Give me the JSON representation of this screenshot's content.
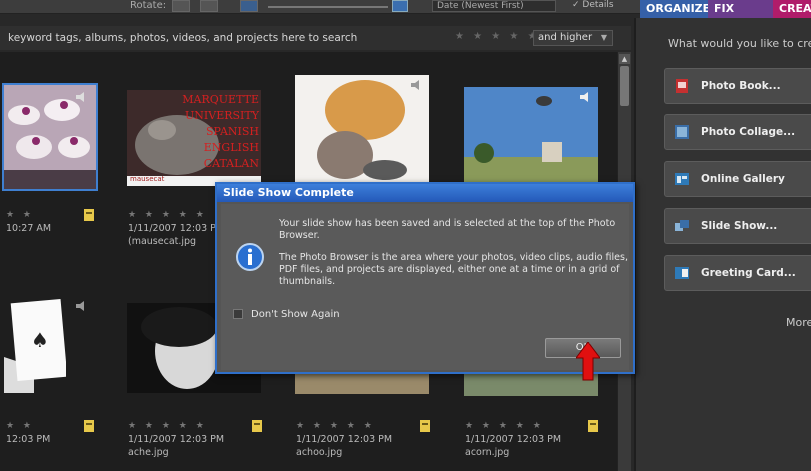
{
  "toolbar": {
    "rotate_label": "Rotate:",
    "sort_value": "Date (Newest First)",
    "details_label": "Details"
  },
  "tabs": [
    {
      "label": "ORGANIZE"
    },
    {
      "label": "FIX"
    },
    {
      "label": "CREATE"
    }
  ],
  "search": {
    "hint": "keyword tags, albums, photos, videos, and projects here to search",
    "rating_filter": "and higher"
  },
  "grid": {
    "items": [
      {
        "date": "10:27 AM",
        "filename": ""
      },
      {
        "date": "1/11/2007 12:03 PM",
        "filename": "(mausecat.jpg"
      },
      {
        "date": "12:03 PM",
        "filename": ""
      },
      {
        "date": "1/11/2007 12:03 PM",
        "filename": "ache.jpg"
      },
      {
        "date": "1/11/2007 12:03 PM",
        "filename": "achoo.jpg"
      },
      {
        "date": "1/11/2007 12:03 PM",
        "filename": "acorn.jpg"
      }
    ],
    "stars": "★ ★ ★ ★ ★",
    "thumb_text": [
      "MARQUETTE",
      "UNIVERSITY",
      "SPANISH",
      "ENGLISH",
      "CATALAN"
    ],
    "thumb_caption": "mausecat"
  },
  "panel": {
    "question": "What would you like to create?",
    "buttons": [
      {
        "label": "Photo Book..."
      },
      {
        "label": "Photo Collage..."
      },
      {
        "label": "Online Gallery"
      },
      {
        "label": "Slide Show..."
      },
      {
        "label": "Greeting Card..."
      }
    ],
    "more": "More"
  },
  "dialog": {
    "title": "Slide Show Complete",
    "message1": "Your slide show has been saved and is selected at the top of the Photo Browser.",
    "message2": "The Photo Browser is the area where your photos, video clips, audio files, PDF files, and projects are displayed, either one at a time or in a grid of thumbnails.",
    "dont_show": "Don't Show Again",
    "ok": "OK"
  },
  "colors": {
    "organize_tab": "#3560a8",
    "fix_tab": "#6a3c8c",
    "create_tab": "#b01c6a",
    "dialog_title": "#2f6fc9",
    "arrow": "#e01010"
  }
}
